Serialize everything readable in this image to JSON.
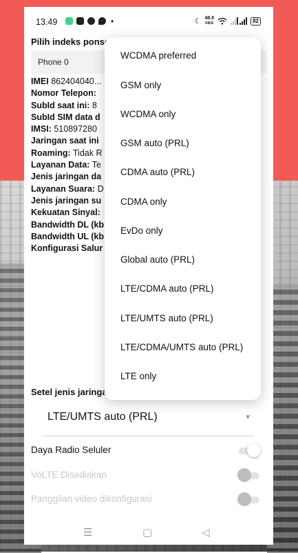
{
  "status_bar": {
    "time": "13.49",
    "net_speed_value": "48.0",
    "net_speed_unit": "KB/S",
    "battery": "82",
    "icons": [
      "app-notification-icon",
      "shopping-bag-icon",
      "facebook-icon",
      "messenger-icon",
      "moon-icon",
      "wifi-icon",
      "signal-icon"
    ],
    "dot": "•"
  },
  "index_label": "Pilih indeks ponsel",
  "phone_selected": "Phone 0",
  "info": [
    {
      "key": "IMEI",
      "value": "862404040..."
    },
    {
      "key": "Nomor Telepon:",
      "value": ""
    },
    {
      "key": "SubId saat ini:",
      "value": "8"
    },
    {
      "key": "SubId SIM data d",
      "value": ""
    },
    {
      "key": "IMSI:",
      "value": "510897280"
    },
    {
      "key": "Jaringan saat ini",
      "value": ""
    },
    {
      "key": "Roaming:",
      "value": "Tidak R"
    },
    {
      "key": "Layanan Data:",
      "value": "Te"
    },
    {
      "key": "Jenis jaringan da",
      "value": ""
    },
    {
      "key": "Layanan Suara:",
      "value": "D"
    },
    {
      "key": "Jenis jaringan su",
      "value": ""
    },
    {
      "key": "Kekuatan Sinyal:",
      "value": ""
    },
    {
      "key": "Bandwidth DL (kb",
      "value": ""
    },
    {
      "key": "Bandwidth UL (kb",
      "value": ""
    },
    {
      "key": "Konfigurasi Salur",
      "value": ""
    }
  ],
  "network_type_label": "Setel jenis jaringan",
  "network_type_selected": "LTE/UMTS auto (PRL)",
  "toggles": [
    {
      "label": "Daya Radio Seluler",
      "enabled": true
    },
    {
      "label": "VoLTE Disediakan",
      "enabled": false
    },
    {
      "label": "Panggilan video dikonfigurasi",
      "enabled": false
    }
  ],
  "nav": {
    "menu": "☰",
    "home": "▢",
    "back": "◁"
  },
  "dropdown": {
    "items": [
      "WCDMA preferred",
      "GSM only",
      "WCDMA only",
      "GSM auto (PRL)",
      "CDMA auto (PRL)",
      "CDMA only",
      "EvDo only",
      "Global auto (PRL)",
      "LTE/CDMA auto (PRL)",
      "LTE/UMTS auto (PRL)",
      "LTE/CDMA/UMTS auto (PRL)",
      "LTE only"
    ]
  },
  "colors": {
    "wallpaper_top": "#f25a55",
    "app_green": "#3dd68c"
  }
}
